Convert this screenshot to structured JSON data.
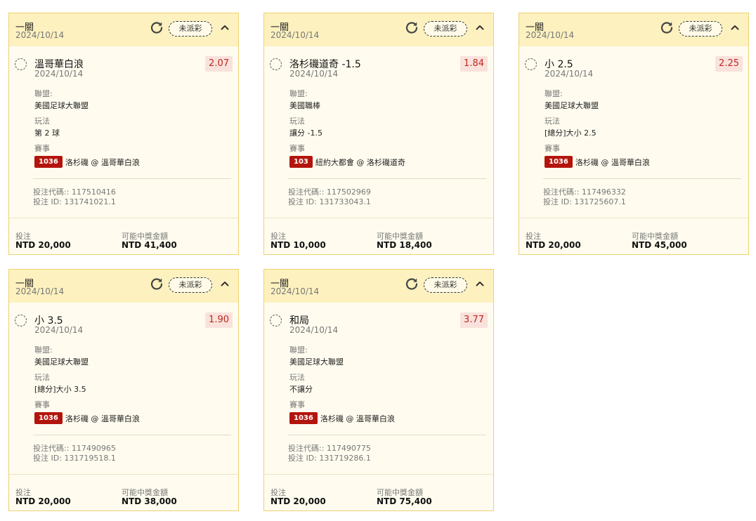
{
  "labels": {
    "status": "未派彩",
    "league": "聯盟:",
    "bet_type": "玩法",
    "event": "賽事",
    "code_prefix": "投注代碼:: ",
    "id_prefix": "投注 ID: ",
    "stake": "投注",
    "payout": "可能中獎金額"
  },
  "icons": {
    "refresh": "refresh-icon",
    "collapse": "chevron-up-icon"
  },
  "colors": {
    "odds": "#c0281e",
    "event_badge": "#b3150d",
    "card_border": "#f0d070"
  },
  "bets": [
    {
      "header_title": "一關",
      "header_date": "2024/10/14",
      "selection": "溫哥華白浪",
      "selection_date": "2024/10/14",
      "odds": "2.07",
      "league": "美國足球大聯盟",
      "bet_type": "第 2 球",
      "event_code": "1036",
      "event_name": "洛杉磯 @ 溫哥華白浪",
      "bet_code": "117510416",
      "bet_id": "131741021.1",
      "stake": "NTD 20,000",
      "payout": "NTD 41,400"
    },
    {
      "header_title": "一關",
      "header_date": "2024/10/14",
      "selection": "洛杉磯道奇 -1.5",
      "selection_date": "2024/10/14",
      "odds": "1.84",
      "league": "美國職棒",
      "bet_type": "讓分 -1.5",
      "event_code": "103",
      "event_name": "紐約大都會 @ 洛杉磯道奇",
      "bet_code": "117502969",
      "bet_id": "131733043.1",
      "stake": "NTD 10,000",
      "payout": "NTD 18,400"
    },
    {
      "header_title": "一關",
      "header_date": "2024/10/14",
      "selection": "小 2.5",
      "selection_date": "2024/10/14",
      "odds": "2.25",
      "league": "美國足球大聯盟",
      "bet_type": "[總分]大小 2.5",
      "event_code": "1036",
      "event_name": "洛杉磯 @ 溫哥華白浪",
      "bet_code": "117496332",
      "bet_id": "131725607.1",
      "stake": "NTD 20,000",
      "payout": "NTD 45,000"
    },
    {
      "header_title": "一關",
      "header_date": "2024/10/14",
      "selection": "小 3.5",
      "selection_date": "2024/10/14",
      "odds": "1.90",
      "league": "美國足球大聯盟",
      "bet_type": "[總分]大小 3.5",
      "event_code": "1036",
      "event_name": "洛杉磯 @ 溫哥華白浪",
      "bet_code": "117490965",
      "bet_id": "131719518.1",
      "stake": "NTD 20,000",
      "payout": "NTD 38,000"
    },
    {
      "header_title": "一關",
      "header_date": "2024/10/14",
      "selection": "和局",
      "selection_date": "2024/10/14",
      "odds": "3.77",
      "league": "美國足球大聯盟",
      "bet_type": "不讓分",
      "event_code": "1036",
      "event_name": "洛杉磯 @ 溫哥華白浪",
      "bet_code": "117490775",
      "bet_id": "131719286.1",
      "stake": "NTD 20,000",
      "payout": "NTD 75,400"
    }
  ]
}
